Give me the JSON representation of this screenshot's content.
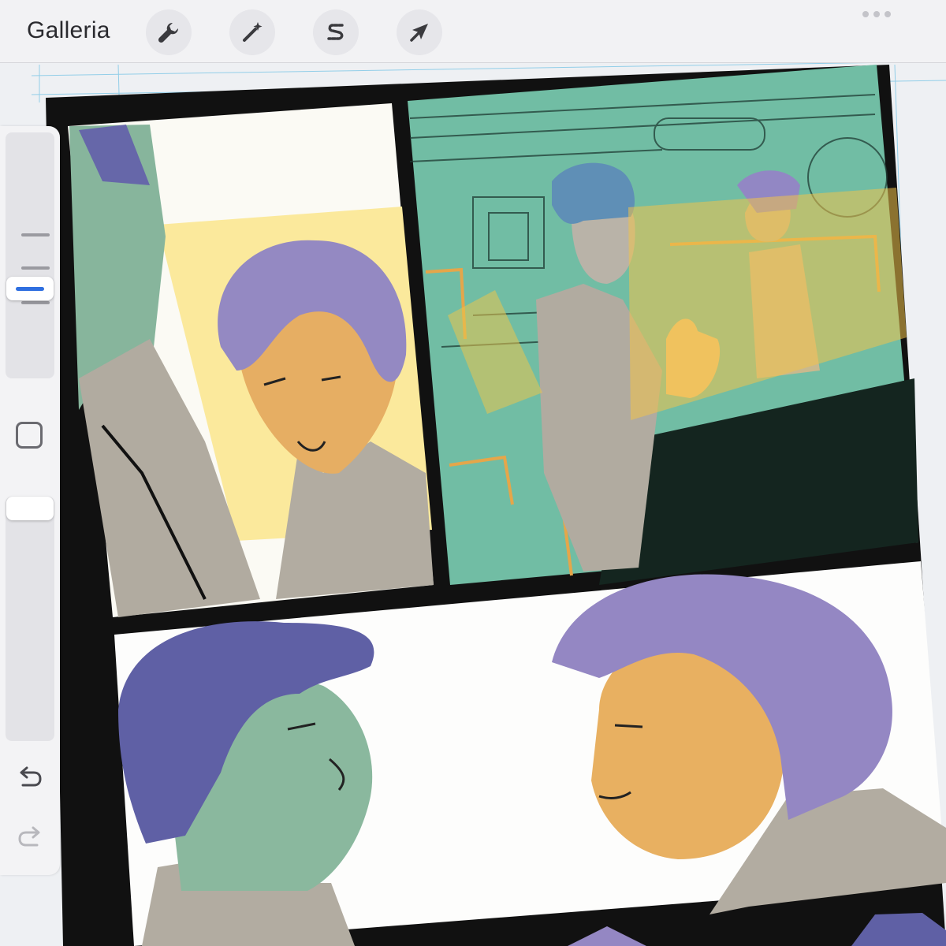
{
  "topbar": {
    "gallery_label": "Galleria",
    "tools": [
      {
        "name": "actions",
        "icon": "wrench-icon"
      },
      {
        "name": "adjustments",
        "icon": "magic-wand-icon"
      },
      {
        "name": "selection",
        "icon": "selection-s-icon"
      },
      {
        "name": "transform",
        "icon": "arrow-cursor-icon"
      }
    ],
    "more_icon": "more-dots-icon"
  },
  "sidebar": {
    "brush_size_level": 0.22,
    "brush_opacity_level": 1.0,
    "modify_icon": "square-icon",
    "undo_icon": "undo-arrow-icon",
    "redo_icon": "redo-arrow-icon"
  },
  "colors": {
    "accent": "#2f6fe0",
    "panel_border": "#111111",
    "skin_orange": "#e9b15f",
    "hair_purple": "#9187c4",
    "hair_dark_purple": "#5b5fa3",
    "skin_green": "#8bbfa2",
    "scene_teal": "#6fbfa3",
    "coat_grey": "#b2aca1",
    "highlight_yellow": "#f4e496"
  }
}
